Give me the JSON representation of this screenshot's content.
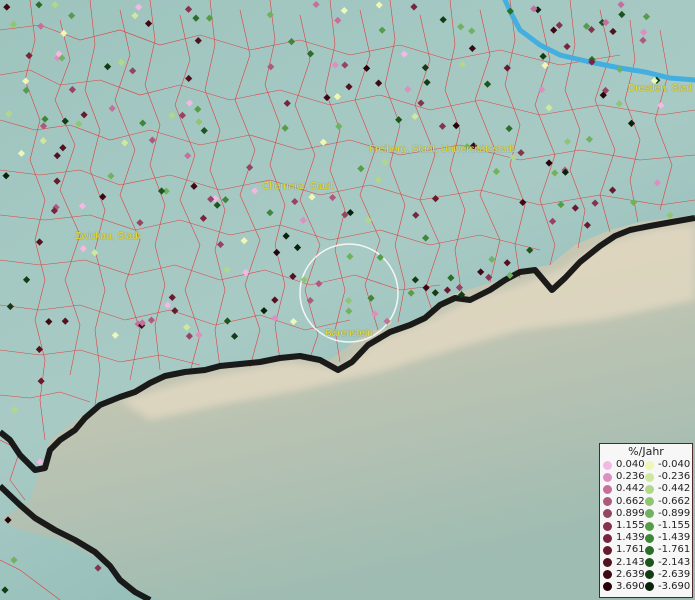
{
  "labels": {
    "dresden": "Dresden, Stad",
    "freiberg": "Freiberg, Stadt, Universitätsstadt",
    "chemnitz": "Chemnitz, Stadt",
    "zwickau": "Zwickau, Stadt",
    "baerenstein": "Bärenstein"
  },
  "legend": {
    "title": "%/Jahr",
    "positive": [
      {
        "value": "0.040",
        "color": "#f3b8e4"
      },
      {
        "value": "0.236",
        "color": "#dd8fc1"
      },
      {
        "value": "0.442",
        "color": "#c56f9d"
      },
      {
        "value": "0.662",
        "color": "#ad5a7f"
      },
      {
        "value": "0.899",
        "color": "#964464"
      },
      {
        "value": "1.155",
        "color": "#86334f"
      },
      {
        "value": "1.439",
        "color": "#77263e"
      },
      {
        "value": "1.761",
        "color": "#661b2f"
      },
      {
        "value": "2.143",
        "color": "#531220"
      },
      {
        "value": "2.639",
        "color": "#3d0a14"
      },
      {
        "value": "3.690",
        "color": "#26040a"
      }
    ],
    "negative": [
      {
        "value": "-0.040",
        "color": "#eef7b4"
      },
      {
        "value": "-0.236",
        "color": "#cfe89e"
      },
      {
        "value": "-0.442",
        "color": "#b1d88a"
      },
      {
        "value": "-0.662",
        "color": "#8fc672"
      },
      {
        "value": "-0.899",
        "color": "#71b25e"
      },
      {
        "value": "-1.155",
        "color": "#559d48"
      },
      {
        "value": "-1.439",
        "color": "#3e8638"
      },
      {
        "value": "-1.761",
        "color": "#2b6d2a"
      },
      {
        "value": "-2.143",
        "color": "#1d551f"
      },
      {
        "value": "-2.639",
        "color": "#133c14"
      },
      {
        "value": "-3.690",
        "color": "#09220a"
      }
    ]
  },
  "colors": {
    "terrain_light": "#a9ccc6",
    "terrain_dark": "#7fb0ab",
    "czech_side": "#d7cbb3",
    "boundary_lines": "#e52c2c",
    "border_line": "#111111",
    "river": "#43aee0",
    "label_text": "#e8e233",
    "highlight_circle": "#ffffff"
  }
}
